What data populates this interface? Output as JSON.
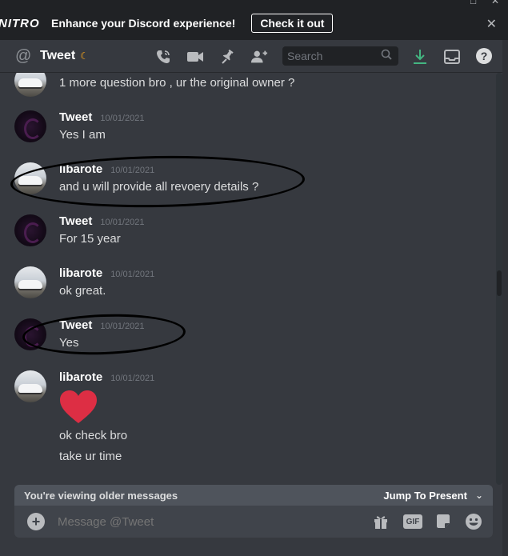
{
  "window": {
    "controls": [
      "□",
      "✕"
    ]
  },
  "banner": {
    "logo": "NITRO",
    "text": "Enhance your Discord experience!",
    "cta": "Check it out",
    "close": "✕"
  },
  "header": {
    "channel_icon": "@",
    "title": "Tweet",
    "status_icon": "moon-icon",
    "search_placeholder": "Search"
  },
  "messages": [
    {
      "id": "m0",
      "author": "",
      "timestamp": "",
      "text": "1 more question bro , ur the original owner ?",
      "avatar": "car"
    },
    {
      "id": "m1",
      "author": "Tweet",
      "timestamp": "10/01/2021",
      "text": "Yes I am",
      "avatar": "tweet"
    },
    {
      "id": "m2",
      "author": "libarote",
      "timestamp": "10/01/2021",
      "text": "and u will provide all revoery details ?",
      "avatar": "car"
    },
    {
      "id": "m3",
      "author": "Tweet",
      "timestamp": "10/01/2021",
      "text": "For 15 year",
      "avatar": "tweet"
    },
    {
      "id": "m4",
      "author": "libarote",
      "timestamp": "10/01/2021",
      "text": "ok great.",
      "avatar": "car"
    },
    {
      "id": "m5",
      "author": "Tweet",
      "timestamp": "10/01/2021",
      "text": "Yes",
      "avatar": "tweet"
    },
    {
      "id": "m6",
      "author": "libarote",
      "timestamp": "10/01/2021",
      "emoji": "heart-icon",
      "lines": [
        "ok check bro",
        "take ur time"
      ],
      "avatar": "car"
    }
  ],
  "older_bar": {
    "text": "You're viewing older messages",
    "jump": "Jump To Present"
  },
  "composer": {
    "placeholder": "Message @Tweet",
    "gif_label": "GIF"
  },
  "colors": {
    "background": "#36393f",
    "banner": "#202225",
    "download_green": "#43b581",
    "heart_red": "#dd2e44"
  }
}
